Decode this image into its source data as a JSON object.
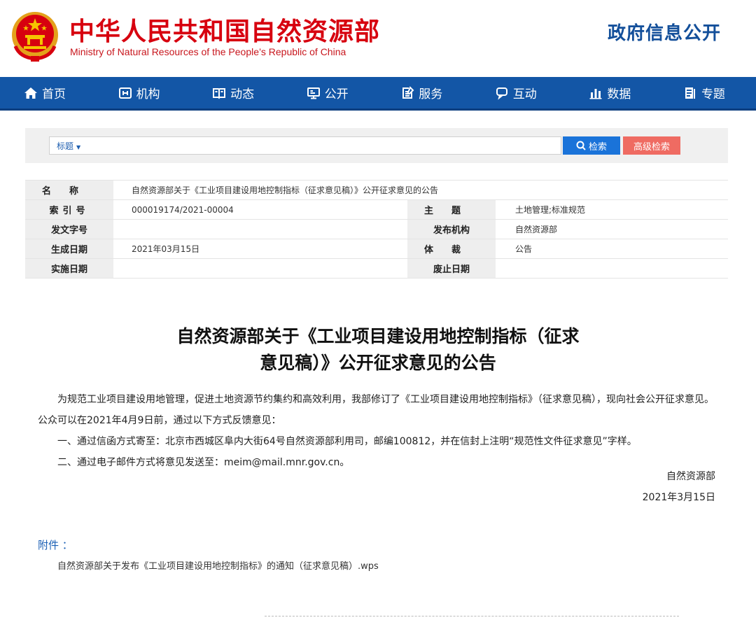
{
  "header": {
    "site_title": "中华人民共和国自然资源部",
    "site_subtitle": "Ministry of Natural Resources of the People’s Republic of China",
    "gov_info": "政府信息公开"
  },
  "nav": {
    "items": [
      {
        "label": "首页",
        "icon": "home-icon"
      },
      {
        "label": "机构",
        "icon": "organization-icon"
      },
      {
        "label": "动态",
        "icon": "news-icon"
      },
      {
        "label": "公开",
        "icon": "monitor-icon"
      },
      {
        "label": "服务",
        "icon": "service-icon"
      },
      {
        "label": "互动",
        "icon": "chat-icon"
      },
      {
        "label": "数据",
        "icon": "bar-chart-icon"
      },
      {
        "label": "专题",
        "icon": "topic-icon"
      }
    ]
  },
  "search": {
    "field_select": "标题",
    "input_value": "",
    "search_button": "检索",
    "advanced_button": "高级检索"
  },
  "info": {
    "name_label": "名称",
    "name_value": "自然资源部关于《工业项目建设用地控制指标（征求意见稿）》公开征求意见的公告",
    "index_label": "索引号",
    "index_value": "000019174/2021-00004",
    "topic_label": "主题",
    "topic_value": "土地管理;标准规范",
    "doc_no_label": "发文字号",
    "doc_no_value": "",
    "publisher_label": "发布机构",
    "publisher_value": "自然资源部",
    "date_label": "生成日期",
    "date_value": "2021年03月15日",
    "genre_label": "体裁",
    "genre_value": "公告",
    "effective_label": "实施日期",
    "effective_value": "",
    "expire_label": "废止日期",
    "expire_value": ""
  },
  "article": {
    "title_line1": "自然资源部关于《工业项目建设用地控制指标（征求",
    "title_line2": "意见稿）》公开征求意见的公告",
    "para1": "为规范工业项目建设用地管理，促进土地资源节约集约和高效利用，我部修订了《工业项目建设用地控制指标》（征求意见稿），现向社会公开征求意见。公众可以在2021年4月9日前，通过以下方式反馈意见：",
    "para2": "一、通过信函方式寄至：北京市西城区阜内大街64号自然资源部利用司，邮编100812，并在信封上注明“规范性文件征求意见”字样。",
    "para3": "二、通过电子邮件方式将意见发送至：meim@mail.mnr.gov.cn。",
    "signature_org": "自然资源部",
    "signature_date": "2021年3月15日"
  },
  "attachment": {
    "label": "附件 ：",
    "file": "自然资源部关于发布《工业项目建设用地控制指标》的通知（征求意见稿）.wps"
  },
  "colors": {
    "title_red": "#d7000f",
    "nav_blue": "#1356a6",
    "search_blue": "#1a73d9",
    "advanced_red": "#ef6b62",
    "link_blue": "#1a5fb4"
  }
}
